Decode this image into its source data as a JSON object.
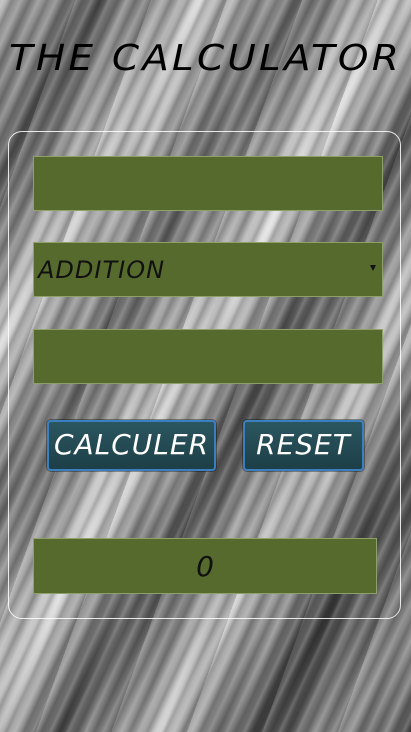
{
  "app": {
    "title": "THE CALCULATOR"
  },
  "form": {
    "first_number": {
      "value": "",
      "placeholder": ""
    },
    "operation": {
      "selected": "ADDITION",
      "icon": "dropdown-arrow-icon"
    },
    "second_number": {
      "value": "",
      "placeholder": ""
    },
    "calculate_label": "CALCULER",
    "reset_label": "RESET",
    "result": "0"
  },
  "colors": {
    "lcd_background": "#566a2e",
    "button_background": "#1d3f47",
    "button_border": "#3a7fc0",
    "title_text": "#000000"
  }
}
